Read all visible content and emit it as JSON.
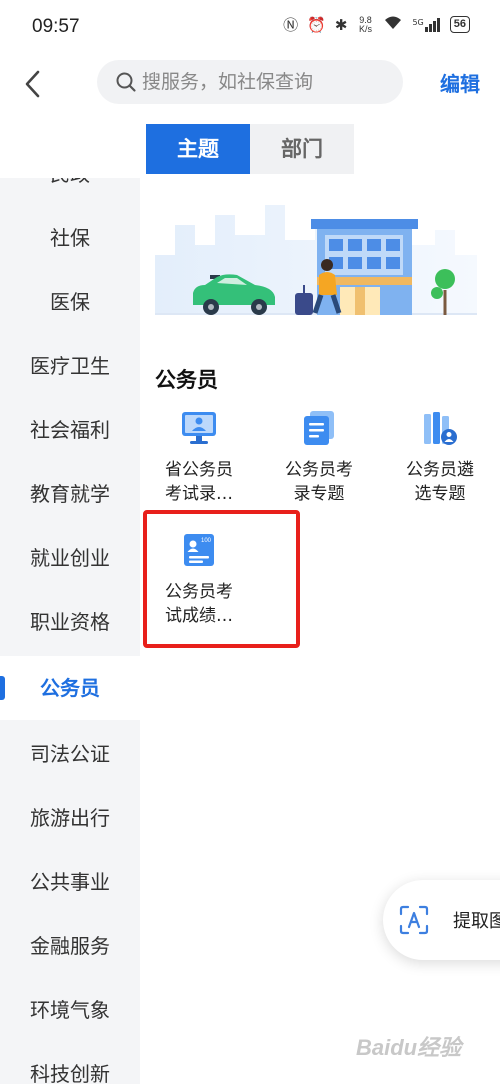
{
  "status_bar": {
    "time": "09:57",
    "net_speed": "9.8",
    "net_unit": "K/s",
    "signal_label": "5G",
    "battery": "56"
  },
  "header": {
    "search_placeholder": "搜服务，如社保查询",
    "edit_label": "编辑"
  },
  "tabs": [
    {
      "label": "主题",
      "active": true
    },
    {
      "label": "部门",
      "active": false
    }
  ],
  "sidebar": {
    "items": [
      {
        "label": "民政"
      },
      {
        "label": "社保"
      },
      {
        "label": "医保"
      },
      {
        "label": "医疗卫生"
      },
      {
        "label": "社会福利"
      },
      {
        "label": "教育就学"
      },
      {
        "label": "就业创业"
      },
      {
        "label": "职业资格"
      },
      {
        "label": "公务员",
        "active": true
      },
      {
        "label": "司法公证"
      },
      {
        "label": "旅游出行"
      },
      {
        "label": "公共事业"
      },
      {
        "label": "金融服务"
      },
      {
        "label": "环境气象"
      },
      {
        "label": "科技创新"
      }
    ]
  },
  "section": {
    "title": "公务员",
    "services": [
      {
        "line1": "省公务员",
        "line2": "考试录…",
        "icon": "monitor-person-icon"
      },
      {
        "line1": "公务员考",
        "line2": "录专题",
        "icon": "document-stack-icon"
      },
      {
        "line1": "公务员遴",
        "line2": "选专题",
        "icon": "books-person-icon"
      },
      {
        "line1": "公务员考",
        "line2": "试成绩…",
        "icon": "score-card-icon"
      }
    ]
  },
  "floating_button": {
    "label": "提取图",
    "icon": "text-extract-icon"
  },
  "watermark": "Baidu经验",
  "colors": {
    "accent": "#1e6fe0",
    "highlight": "#e8201b",
    "sidebar_bg": "#f4f5f7"
  }
}
